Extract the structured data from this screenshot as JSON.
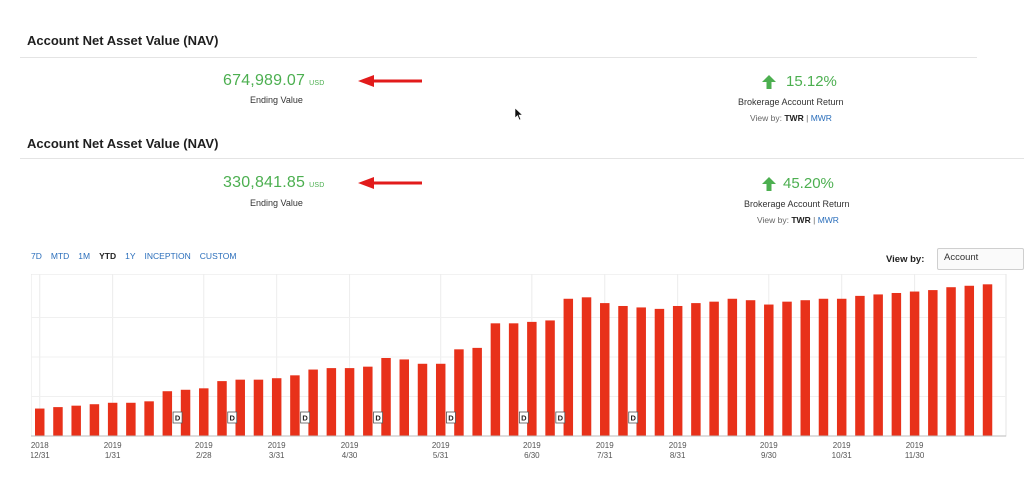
{
  "section1": {
    "title": "Account Net Asset Value (NAV)",
    "ending_value": "674,989.07",
    "currency": "USD",
    "ending_label": "Ending Value",
    "return_value": "15.12%",
    "return_label": "Brokerage Account Return",
    "view_by_prefix": "View by:",
    "twr": "TWR",
    "separator": "|",
    "mwr": "MWR"
  },
  "section2": {
    "title": "Account Net Asset Value (NAV)",
    "ending_value": "330,841.85",
    "currency": "USD",
    "ending_label": "Ending Value",
    "return_value": "45.20%",
    "return_label": "Brokerage Account Return",
    "view_by_prefix": "View by:",
    "twr": "TWR",
    "separator": "|",
    "mwr": "MWR"
  },
  "period_tabs": [
    {
      "label": "7D",
      "active": false
    },
    {
      "label": "MTD",
      "active": false
    },
    {
      "label": "1M",
      "active": false
    },
    {
      "label": "YTD",
      "active": true
    },
    {
      "label": "1Y",
      "active": false
    },
    {
      "label": "INCEPTION",
      "active": false
    },
    {
      "label": "CUSTOM",
      "active": false
    }
  ],
  "view_by": {
    "label": "View by:",
    "selected": "Account"
  },
  "colors": {
    "green": "#4caf50",
    "red_bar": "#e8311a",
    "arrow_red": "#e21b1b",
    "link_blue": "#2a6ebb"
  },
  "icons": {
    "annotation_arrow": "red-left-arrow",
    "return_arrow": "green-up-arrow",
    "mouse_cursor": "pointer-arrow"
  },
  "chart_data": {
    "type": "bar",
    "title": "",
    "xlabel": "",
    "ylabel": "",
    "grid": true,
    "values": [
      0.19,
      0.2,
      0.21,
      0.22,
      0.23,
      0.23,
      0.24,
      0.31,
      0.32,
      0.33,
      0.38,
      0.39,
      0.39,
      0.4,
      0.42,
      0.46,
      0.47,
      0.47,
      0.48,
      0.54,
      0.53,
      0.5,
      0.5,
      0.6,
      0.61,
      0.78,
      0.78,
      0.79,
      0.8,
      0.95,
      0.96,
      0.92,
      0.9,
      0.89,
      0.88,
      0.9,
      0.92,
      0.93,
      0.95,
      0.94,
      0.91,
      0.93,
      0.94,
      0.95,
      0.95,
      0.97,
      0.98,
      0.99,
      1.0,
      1.01,
      1.03,
      1.04,
      1.05
    ],
    "value_unit": "fraction of plot height",
    "dividend_markers_at": [
      7,
      10,
      14,
      18,
      22,
      26,
      28,
      32
    ],
    "dividend_label": "D",
    "x_ticks": [
      {
        "year": "2018",
        "date": "12/31",
        "index": 0
      },
      {
        "year": "2019",
        "date": "1/31",
        "index": 4
      },
      {
        "year": "2019",
        "date": "2/28",
        "index": 9
      },
      {
        "year": "2019",
        "date": "3/31",
        "index": 13
      },
      {
        "year": "2019",
        "date": "4/30",
        "index": 17
      },
      {
        "year": "2019",
        "date": "5/31",
        "index": 22
      },
      {
        "year": "2019",
        "date": "6/30",
        "index": 27
      },
      {
        "year": "2019",
        "date": "7/31",
        "index": 31
      },
      {
        "year": "2019",
        "date": "8/31",
        "index": 35
      },
      {
        "year": "2019",
        "date": "9/30",
        "index": 40
      },
      {
        "year": "2019",
        "date": "10/31",
        "index": 44
      },
      {
        "year": "2019",
        "date": "11/30",
        "index": 48
      }
    ]
  }
}
